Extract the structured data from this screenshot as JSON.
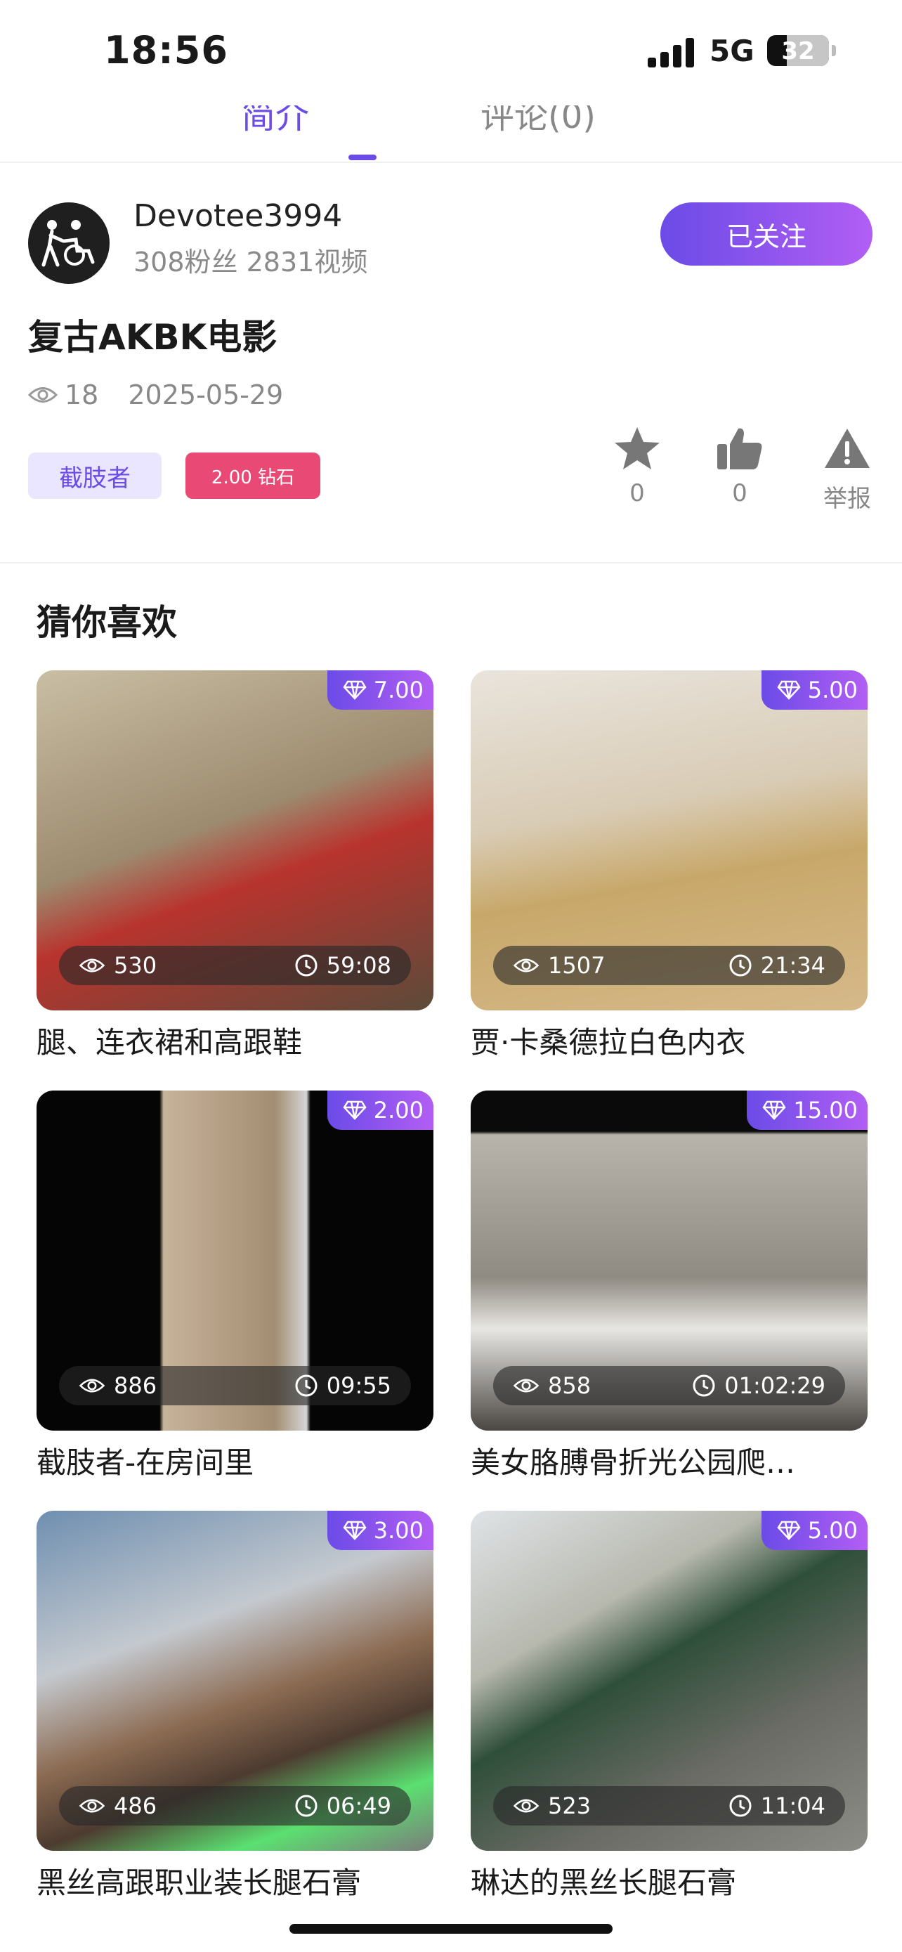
{
  "status_bar": {
    "time": "18:56",
    "network": "5G",
    "battery": "32",
    "battery_level": 0.32
  },
  "tabs": [
    {
      "label": "简介",
      "active": true
    },
    {
      "label": "评论(0)",
      "active": false
    }
  ],
  "author": {
    "name": "Devotee3994",
    "stats": "308粉丝 2831视频",
    "follow_label": "已关注"
  },
  "video": {
    "title": "复古AKBK电影",
    "views": "18",
    "date": "2025-05-29"
  },
  "tags": {
    "category": "截肢者",
    "price": "2.00 钻石"
  },
  "actions": [
    {
      "icon": "star-icon",
      "count": "0"
    },
    {
      "icon": "thumbs-up-icon",
      "count": "0"
    },
    {
      "icon": "warning-icon",
      "label": "举报"
    }
  ],
  "recommend": {
    "title": "猜你喜欢",
    "items": [
      {
        "price": "7.00",
        "views": "530",
        "duration": "59:08",
        "title": "腿、连衣裙和高跟鞋"
      },
      {
        "price": "5.00",
        "views": "1507",
        "duration": "21:34",
        "title": "贾·卡桑德拉白色内衣"
      },
      {
        "price": "2.00",
        "views": "886",
        "duration": "09:55",
        "title": "截肢者-在房间里"
      },
      {
        "price": "15.00",
        "views": "858",
        "duration": "01:02:29",
        "title": "美女胳膊骨折光公园爬…"
      },
      {
        "price": "3.00",
        "views": "486",
        "duration": "06:49",
        "title": "黑丝高跟职业装长腿石膏"
      },
      {
        "price": "5.00",
        "views": "523",
        "duration": "11:04",
        "title": "琳达的黑丝长腿石膏"
      }
    ]
  },
  "colors": {
    "accent": "#6b4ce6",
    "price_tag": "#e84a75",
    "muted": "#888888"
  }
}
